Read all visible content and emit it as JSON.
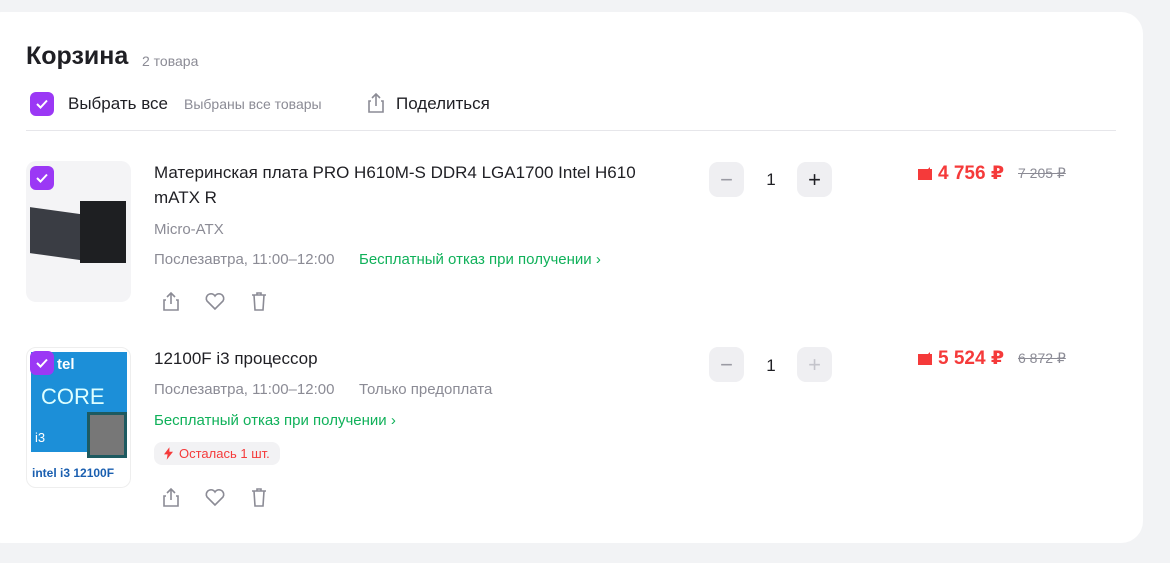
{
  "header": {
    "title": "Корзина",
    "count": "2 товара"
  },
  "toolbar": {
    "select_all": "Выбрать все",
    "selected_info": "Выбраны все товары",
    "share": "Поделиться"
  },
  "colors": {
    "accent": "#9b38f5",
    "price": "#f53a3a",
    "link": "#10b15a"
  },
  "items": [
    {
      "title": "Материнская плата PRO H610M-S DDR4 LGA1700 Intel H610 mATX R",
      "variant": "Micro-ATX",
      "delivery": "Послезавтра, 11:00–12:00",
      "free_return": "Бесплатный отказ при получении ›",
      "quantity": "1",
      "price": "4 756 ₽",
      "old_price": "7 205 ₽",
      "checked": true
    },
    {
      "title": "12100F i3 процессор",
      "delivery": "Послезавтра, 11:00–12:00",
      "prepay": "Только предоплата",
      "free_return": "Бесплатный отказ при получении ›",
      "stock_badge": "Осталась 1 шт.",
      "quantity": "1",
      "price": "5 524 ₽",
      "old_price": "6 872 ₽",
      "checked": true,
      "image_text": {
        "brand": "intel",
        "line": "CORE",
        "tier": "i3",
        "caption": "intel i3 12100F"
      }
    }
  ]
}
